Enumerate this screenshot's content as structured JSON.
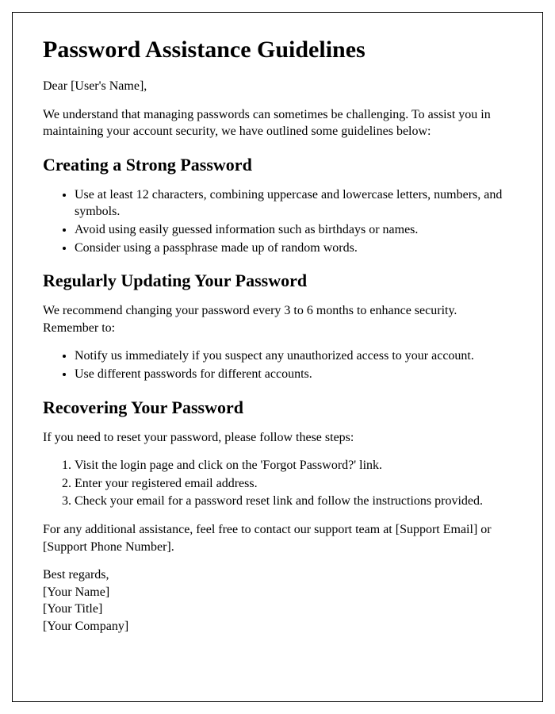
{
  "title": "Password Assistance Guidelines",
  "greeting": "Dear [User's Name],",
  "intro": "We understand that managing passwords can sometimes be challenging. To assist you in maintaining your account security, we have outlined some guidelines below:",
  "section1": {
    "heading": "Creating a Strong Password",
    "items": [
      "Use at least 12 characters, combining uppercase and lowercase letters, numbers, and symbols.",
      "Avoid using easily guessed information such as birthdays or names.",
      "Consider using a passphrase made up of random words."
    ]
  },
  "section2": {
    "heading": "Regularly Updating Your Password",
    "intro": "We recommend changing your password every 3 to 6 months to enhance security. Remember to:",
    "items": [
      "Notify us immediately if you suspect any unauthorized access to your account.",
      "Use different passwords for different accounts."
    ]
  },
  "section3": {
    "heading": "Recovering Your Password",
    "intro": "If you need to reset your password, please follow these steps:",
    "steps": [
      "Visit the login page and click on the 'Forgot Password?' link.",
      "Enter your registered email address.",
      "Check your email for a password reset link and follow the instructions provided."
    ]
  },
  "support": "For any additional assistance, feel free to contact our support team at [Support Email] or [Support Phone Number].",
  "closing": {
    "regards": "Best regards,",
    "name": "[Your Name]",
    "title": "[Your Title]",
    "company": "[Your Company]"
  }
}
